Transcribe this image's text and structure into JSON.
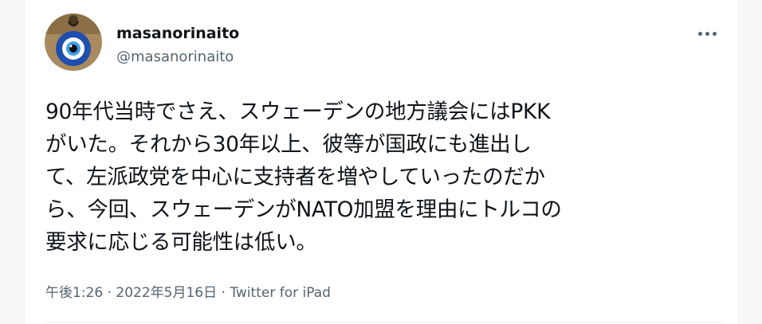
{
  "user": {
    "display_name": "masanorinaito",
    "handle": "@masanorinaito",
    "avatar_icon": "nazar-eye-icon"
  },
  "menu": {
    "more_icon": "more-options-icon"
  },
  "tweet": {
    "lines": [
      "90年代当時でさえ、スウェーデンの地方議会にはPKK",
      "がいた。それから30年以上、彼等が国政にも進出し",
      "て、左派政党を中心に支持者を増やしていったのだか",
      "ら、今回、スウェーデンがNATO加盟を理由にトルコの",
      "要求に応じる可能性は低い。"
    ]
  },
  "meta": {
    "time": "午後1:26",
    "separator": "·",
    "date": "2022年5月16日",
    "source": "Twitter for iPad"
  },
  "colors": {
    "text": "#0f1419",
    "secondary": "#536471",
    "border": "#eff3f4"
  }
}
